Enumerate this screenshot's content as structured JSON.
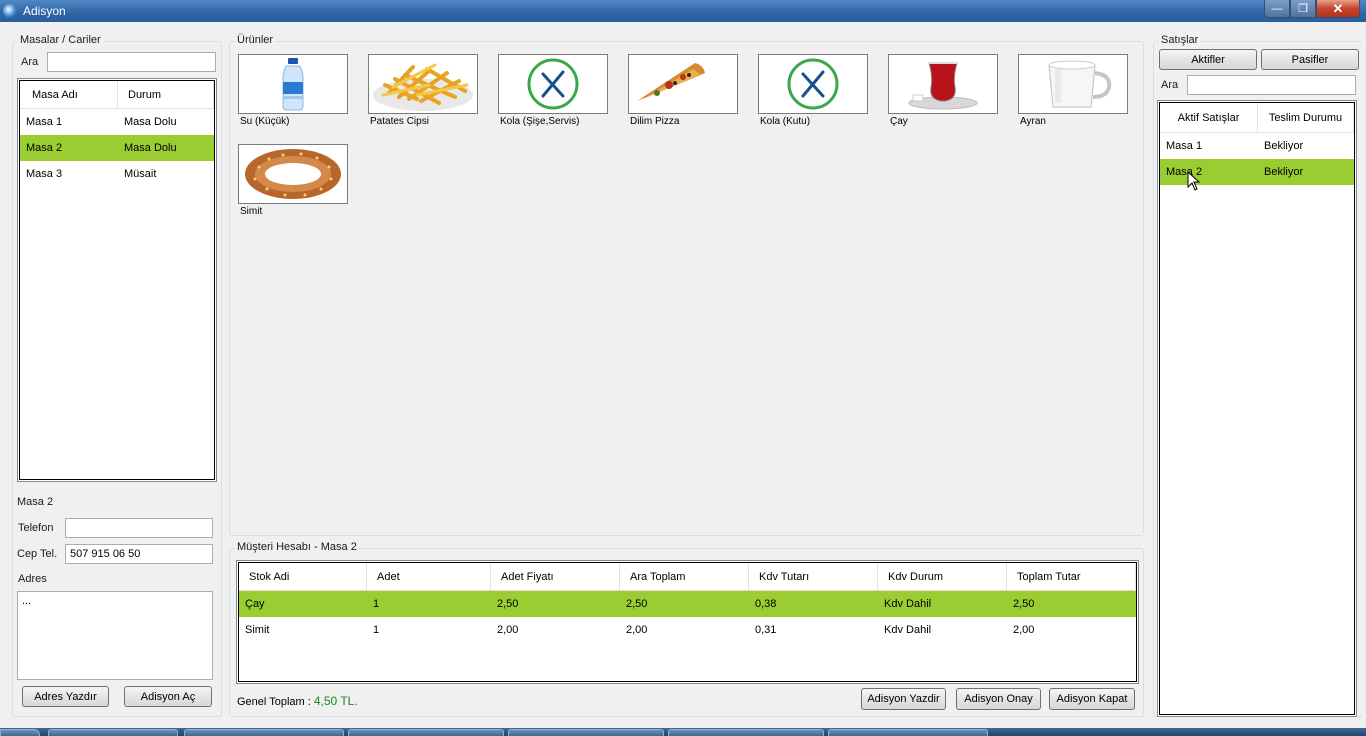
{
  "window": {
    "title": "Adisyon",
    "min_icon": "minimize-icon",
    "max_icon": "maximize-icon",
    "close_icon": "close-icon"
  },
  "masalar": {
    "group_label": "Masalar / Cariler",
    "search_label": "Ara",
    "search_value": "",
    "columns": [
      "Masa Adı",
      "Durum"
    ],
    "rows": [
      {
        "name": "Masa 1",
        "status": "Masa Dolu",
        "selected": false
      },
      {
        "name": "Masa 2",
        "status": "Masa Dolu",
        "selected": true
      },
      {
        "name": "Masa 3",
        "status": "Müsait",
        "selected": false
      }
    ]
  },
  "customer": {
    "title": "Masa 2",
    "phone_label": "Telefon",
    "phone_value": "",
    "mobile_label": "Cep Tel.",
    "mobile_value": "507 915 06 50",
    "address_label": "Adres",
    "address_value": "...",
    "print_address_button": "Adres Yazdır",
    "open_bill_button": "Adisyon Aç"
  },
  "products": {
    "group_label": "Ürünler",
    "items": [
      {
        "name": "Su (Küçük)",
        "icon": "water-bottle-icon"
      },
      {
        "name": "Patates Cipsi",
        "icon": "fries-icon"
      },
      {
        "name": "Kola (Şişe,Servis)",
        "icon": "cutlery-icon"
      },
      {
        "name": "Dilim Pizza",
        "icon": "pizza-icon"
      },
      {
        "name": "Kola (Kutu)",
        "icon": "cutlery-icon"
      },
      {
        "name": "Çay",
        "icon": "tea-glass-icon"
      },
      {
        "name": "Ayran",
        "icon": "ayran-cup-icon"
      },
      {
        "name": "Simit",
        "icon": "simit-icon"
      }
    ]
  },
  "account": {
    "group_label": "Müşteri Hesabı - Masa 2",
    "columns": [
      "Stok Adi",
      "Adet",
      "Adet Fiyatı",
      "Ara Toplam",
      "Kdv Tutarı",
      "Kdv Durum",
      "Toplam Tutar"
    ],
    "rows": [
      {
        "cells": [
          "Çay",
          "1",
          "2,50",
          "2,50",
          "0,38",
          "Kdv Dahil",
          "2,50"
        ],
        "selected": true
      },
      {
        "cells": [
          "Simit",
          "1",
          "2,00",
          "2,00",
          "0,31",
          "Kdv Dahil",
          "2,00"
        ],
        "selected": false
      }
    ],
    "total_label": "Genel Toplam :",
    "total_value": "4,50 TL.",
    "print_button": "Adisyon Yazdir",
    "confirm_button": "Adisyon Onay",
    "close_button": "Adisyon Kapat"
  },
  "sales": {
    "group_label": "Satışlar",
    "active_button": "Aktifler",
    "passive_button": "Pasifler",
    "search_label": "Ara",
    "search_value": "",
    "columns": [
      "Aktif Satışlar",
      "Teslim Durumu"
    ],
    "rows": [
      {
        "name": "Masa 1",
        "status": "Bekliyor",
        "selected": false
      },
      {
        "name": "Masa 2",
        "status": "Bekliyor",
        "selected": true
      }
    ]
  },
  "colors": {
    "selection": "#9acd32",
    "total_value": "#1e8a1e",
    "titlebar": "#2f64a6"
  }
}
